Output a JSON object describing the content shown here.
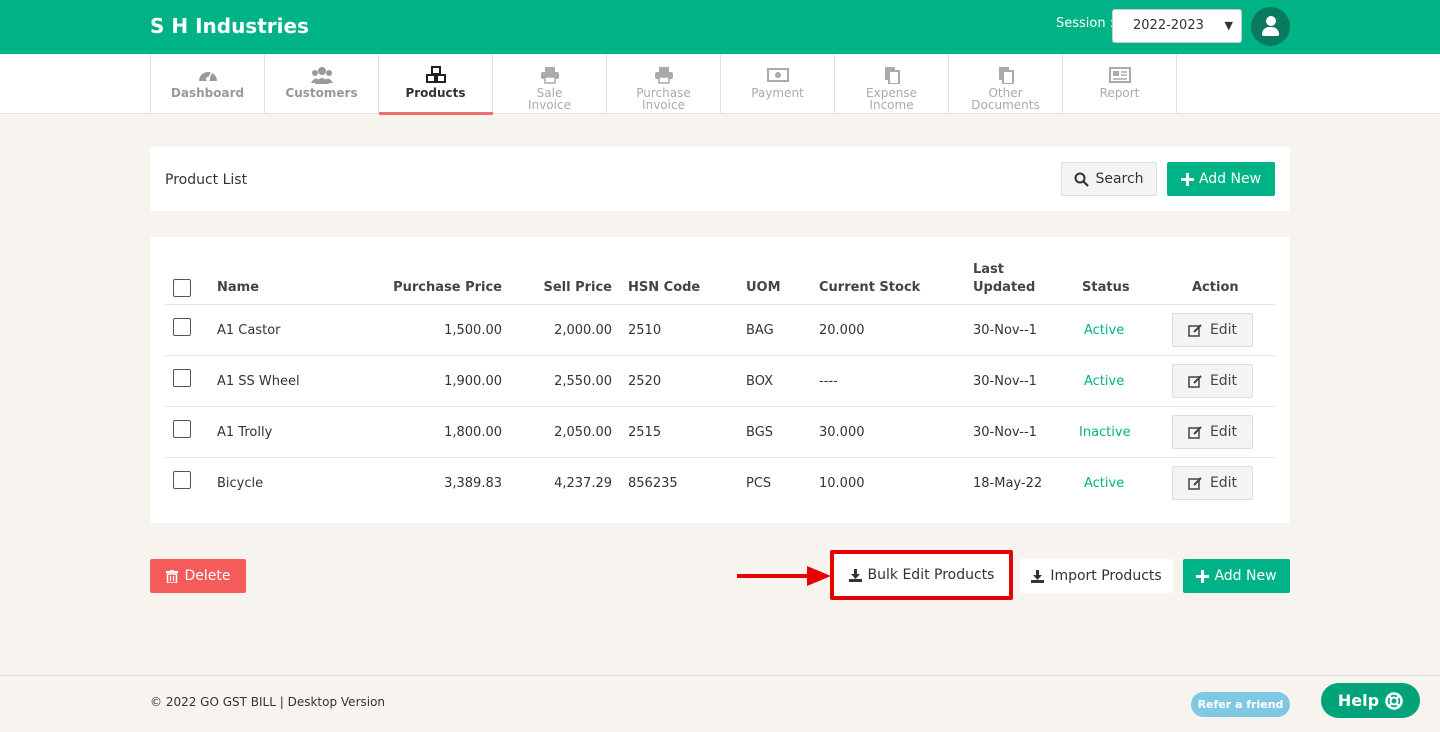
{
  "header": {
    "brand": "S H Industries",
    "session_label": "Session :",
    "session_value": "2022-2023"
  },
  "nav": {
    "items": [
      {
        "line1": "Dashboard",
        "line2": ""
      },
      {
        "line1": "Customers",
        "line2": ""
      },
      {
        "line1": "Products",
        "line2": ""
      },
      {
        "line1": "Sale",
        "line2": "Invoice"
      },
      {
        "line1": "Purchase",
        "line2": "Invoice"
      },
      {
        "line1": "Payment",
        "line2": ""
      },
      {
        "line1": "Expense",
        "line2": "Income"
      },
      {
        "line1": "Other",
        "line2": "Documents"
      },
      {
        "line1": "Report",
        "line2": ""
      }
    ]
  },
  "product_list": {
    "title": "Product List",
    "search_label": "Search",
    "add_new_label": "Add New"
  },
  "table": {
    "headers": {
      "name": "Name",
      "purchase_price": "Purchase Price",
      "sell_price": "Sell Price",
      "hsn_code": "HSN Code",
      "uom": "UOM",
      "current_stock": "Current Stock",
      "last_updated_line1": "Last",
      "last_updated_line2": "Updated",
      "status": "Status",
      "action": "Action"
    },
    "rows": [
      {
        "name": "A1 Castor",
        "purchase_price": "1,500.00",
        "sell_price": "2,000.00",
        "hsn": "2510",
        "uom": "BAG",
        "stock": "20.000",
        "updated": "30-Nov--1",
        "status": "Active",
        "action": "Edit"
      },
      {
        "name": "A1 SS Wheel",
        "purchase_price": "1,900.00",
        "sell_price": "2,550.00",
        "hsn": "2520",
        "uom": "BOX",
        "stock": "----",
        "updated": "30-Nov--1",
        "status": "Active",
        "action": "Edit"
      },
      {
        "name": "A1 Trolly",
        "purchase_price": "1,800.00",
        "sell_price": "2,050.00",
        "hsn": "2515",
        "uom": "BGS",
        "stock": "30.000",
        "updated": "30-Nov--1",
        "status": "Inactive",
        "action": "Edit"
      },
      {
        "name": "Bicycle",
        "purchase_price": "3,389.83",
        "sell_price": "4,237.29",
        "hsn": "856235",
        "uom": "PCS",
        "stock": "10.000",
        "updated": "18-May-22",
        "status": "Active",
        "action": "Edit"
      }
    ]
  },
  "actions": {
    "delete_label": "Delete",
    "bulk_edit_label": "Bulk Edit Products",
    "import_label": "Import Products",
    "add_new_label": "Add New"
  },
  "footer": {
    "text": "© 2022 GO GST BILL  | Desktop Version",
    "refer_label": "Refer a friend",
    "help_label": "Help"
  },
  "colors": {
    "brand_green": "#00b386",
    "danger_red": "#f45b5b",
    "highlight_red": "#e60000",
    "active_tab_underline": "#f07070"
  }
}
